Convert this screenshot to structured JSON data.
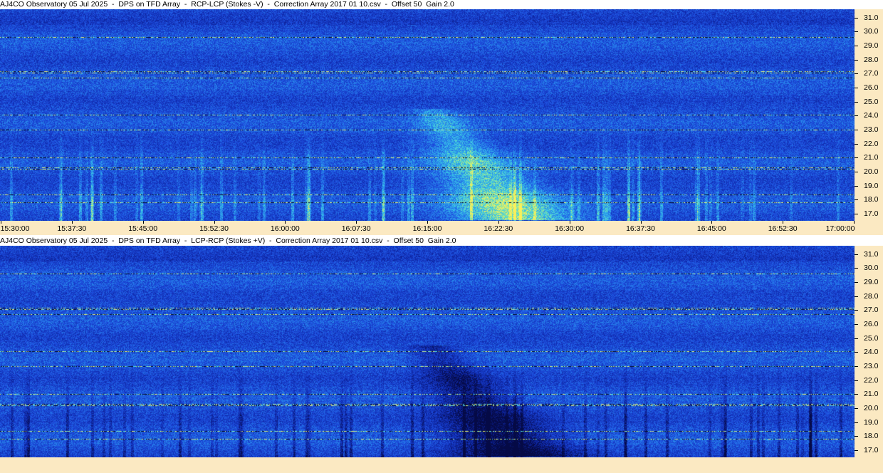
{
  "chart_data": [
    {
      "type": "heatmap",
      "title": "AJ4CO Observatory 05 Jul 2025  -  DPS on TFD Array  -  RCP-LCP (Stokes -V)  -  Correction Array 2017 01 10.csv  -  Offset 50  Gain 2.0",
      "y_ticks": [
        "31.0",
        "30.0",
        "29.0",
        "28.0",
        "27.0",
        "26.0",
        "25.0",
        "24.0",
        "23.0",
        "22.0",
        "21.0",
        "20.0",
        "19.0",
        "18.0",
        "17.0"
      ],
      "x_ticks": [
        "15:30:00",
        "15:37:30",
        "15:45:00",
        "15:52:30",
        "16:00:00",
        "16:07:30",
        "16:15:00",
        "16:22:30",
        "16:30:00",
        "16:37:30",
        "16:45:00",
        "16:52:30",
        "17:00:00"
      ],
      "x_range": [
        "15:30:00",
        "17:00:00"
      ],
      "y_range": [
        16.5,
        31.6
      ],
      "polarity": "bright"
    },
    {
      "type": "heatmap",
      "title": "AJ4CO Observatory 05 Jul 2025  -  DPS on TFD Array  -  LCP-RCP (Stokes +V)  -  Correction Array 2017 01 10.csv  -  Offset 50  Gain 2.0",
      "y_ticks": [
        "31.0",
        "30.0",
        "29.0",
        "28.0",
        "27.0",
        "26.0",
        "25.0",
        "24.0",
        "23.0",
        "22.0",
        "21.0",
        "20.0",
        "19.0",
        "18.0",
        "17.0"
      ],
      "x_range": [
        "15:30:00",
        "17:00:00"
      ],
      "y_range": [
        16.5,
        31.6
      ],
      "polarity": "dark"
    }
  ]
}
